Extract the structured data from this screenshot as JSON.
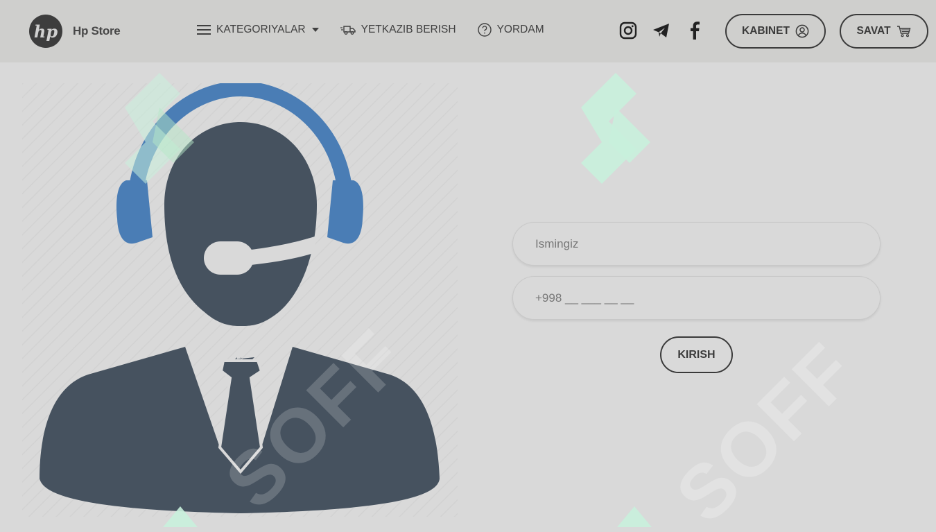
{
  "brand": {
    "logo_mark": "hp",
    "name": "Hp Store"
  },
  "nav": {
    "categories_label": "KATEGORIYALAR",
    "delivery_label": "YETKAZIB BERISH",
    "help_label": "YORDAM"
  },
  "socials": [
    "instagram-icon",
    "telegram-icon",
    "facebook-icon"
  ],
  "header_buttons": {
    "cabinet_label": "KABINET",
    "cart_label": "SAVAT"
  },
  "form": {
    "name_placeholder": "Ismingiz",
    "phone_placeholder": "+998 __ ___ __ __",
    "submit_label": "KIRISH"
  },
  "watermark": {
    "text": "SOFF"
  },
  "colors": {
    "background": "#d9d9d9",
    "header": "#cfcfcd",
    "headset_blue": "#4a7db5",
    "figure": "#46525f",
    "watermark_green": "#c8f0dc"
  }
}
